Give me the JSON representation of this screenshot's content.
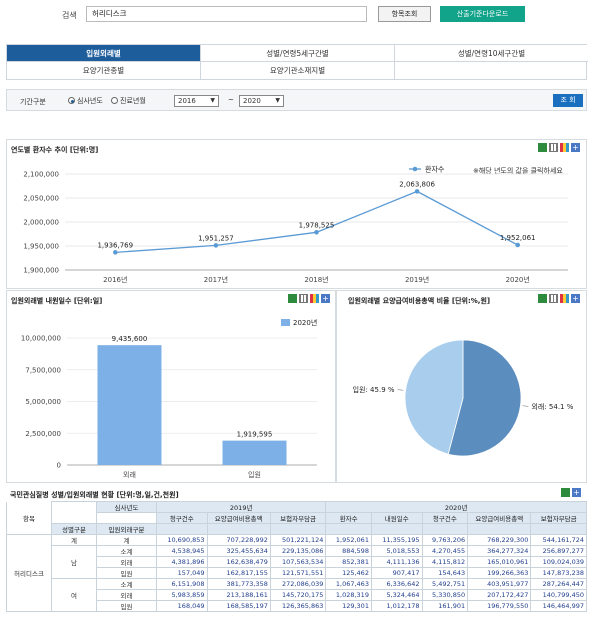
{
  "search": {
    "label": "검색",
    "value": "허리디스크",
    "btn_query": "항목조회",
    "btn_download": "산출기준다운로드"
  },
  "tabs": [
    {
      "label": "입원외래별",
      "active": true
    },
    {
      "label": "성별/연령5세구간별",
      "active": false
    },
    {
      "label": "성별/연령10세구간별",
      "active": false
    },
    {
      "label": "요양기관종별",
      "active": false
    },
    {
      "label": "요양기관소재지별",
      "active": false
    }
  ],
  "filter": {
    "label": "기간구분",
    "opt1": "심사년도",
    "opt2": "진료년월",
    "from": "2016",
    "tilde": "~",
    "to": "2020",
    "btn": "조 회"
  },
  "chart1": {
    "title": "연도별 환자수 추이 [단위:명]",
    "note": "※해당 년도의 값을 클릭하세요"
  },
  "chart2": {
    "title": "입원외래별 내원일수 [단위:일]"
  },
  "chart3": {
    "title": "입원외래별 요양급여비용총액 비율 [단위:%,원]"
  },
  "table": {
    "title": "국민관심질병 성별/입원외래별 현황 [단위:명,일,건,천원]"
  },
  "chart_data": [
    {
      "type": "line",
      "title": "연도별 환자수 추이 [단위:명]",
      "x": [
        "2016년",
        "2017년",
        "2018년",
        "2019년",
        "2020년"
      ],
      "series": [
        {
          "name": "환자수",
          "values": [
            1936769,
            1951257,
            1978525,
            2063806,
            1952061
          ],
          "labels": [
            "1,936,769",
            "1,951,257",
            "1,978,525",
            "2,063,806",
            "1,952,061"
          ]
        }
      ],
      "ylim": [
        1900000,
        2100000
      ],
      "yticks": [
        "1,900,000",
        "1,950,000",
        "2,000,000",
        "2,050,000",
        "2,100,000"
      ],
      "color": "#5b9bd5",
      "legend": "top-right"
    },
    {
      "type": "bar",
      "title": "입원외래별 내원일수 [단위:일]",
      "categories": [
        "외래",
        "입원"
      ],
      "series": [
        {
          "name": "2020년",
          "values": [
            9435600,
            1919595
          ],
          "labels": [
            "9,435,600",
            "1,919,595"
          ]
        }
      ],
      "ylim": [
        0,
        10000000
      ],
      "yticks": [
        "0",
        "2,500,000",
        "5,000,000",
        "7,500,000",
        "10,000,000"
      ],
      "color": "#7cb0e6",
      "legend": "top"
    },
    {
      "type": "pie",
      "title": "입원외래별 요양급여비용총액 비율 [단위:%,원]",
      "slices": [
        {
          "label": "외래",
          "value": 54.1,
          "text": "외래: 54.1 %",
          "color": "#5b8dbf"
        },
        {
          "label": "입원",
          "value": 45.9,
          "text": "입원: 45.9 %",
          "color": "#a9cdec"
        }
      ]
    }
  ],
  "grid": {
    "h1": [
      "항목",
      "성별구분",
      "입원외래구분"
    ],
    "top_first": "심사년도",
    "y2019": "2019년",
    "y2020": "2020년",
    "cols": [
      "청구건수",
      "요양급여비용총액",
      "보험자부담금",
      "환자수",
      "내원일수",
      "청구건수",
      "요양급여비용총액",
      "보험자부담금"
    ],
    "item": "허리디스크",
    "groups": [
      {
        "sex": "계",
        "rows": [
          {
            "type": "계",
            "v": [
              "10,690,853",
              "707,228,992",
              "501,221,124",
              "1,952,061",
              "11,355,195",
              "9,763,206",
              "768,229,300",
              "544,161,724"
            ]
          }
        ]
      },
      {
        "sex": "남",
        "rows": [
          {
            "type": "소계",
            "v": [
              "4,538,945",
              "325,455,634",
              "229,135,086",
              "884,598",
              "5,018,553",
              "4,270,455",
              "364,277,324",
              "256,897,277"
            ]
          },
          {
            "type": "외래",
            "v": [
              "4,381,896",
              "162,638,479",
              "107,563,534",
              "852,381",
              "4,111,136",
              "4,115,812",
              "165,010,961",
              "109,024,039"
            ]
          },
          {
            "type": "입원",
            "v": [
              "157,049",
              "162,817,155",
              "121,571,551",
              "125,462",
              "907,417",
              "154,643",
              "199,266,363",
              "147,873,238"
            ]
          }
        ]
      },
      {
        "sex": "여",
        "rows": [
          {
            "type": "소계",
            "v": [
              "6,151,908",
              "381,773,358",
              "272,086,039",
              "1,067,463",
              "6,336,642",
              "5,492,751",
              "403,951,977",
              "287,264,447"
            ]
          },
          {
            "type": "외래",
            "v": [
              "5,983,859",
              "213,188,161",
              "145,720,175",
              "1,028,319",
              "5,324,464",
              "5,330,850",
              "207,172,427",
              "140,799,450"
            ]
          },
          {
            "type": "입원",
            "v": [
              "168,049",
              "168,585,197",
              "126,365,863",
              "129,301",
              "1,012,178",
              "161,901",
              "196,779,550",
              "146,464,997"
            ]
          }
        ]
      }
    ]
  }
}
